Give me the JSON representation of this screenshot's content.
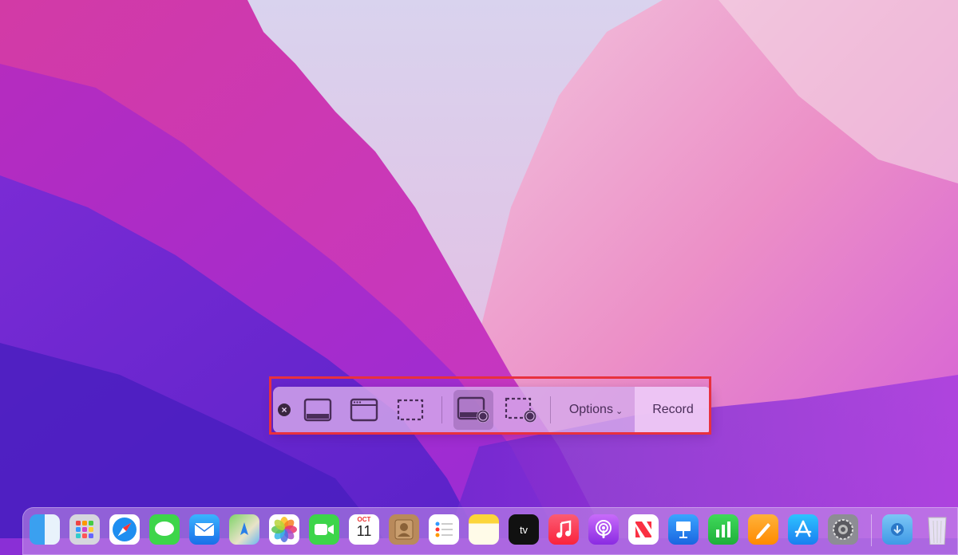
{
  "colors": {
    "highlight": "#e8313e",
    "toolbar_bg": "#d6aaeb",
    "toolbar_text": "#4a2d59"
  },
  "toolbar": {
    "close_icon": "close-icon",
    "tools": [
      {
        "name": "capture-entire-screen",
        "icon": "screen-icon",
        "selected": false
      },
      {
        "name": "capture-selected-window",
        "icon": "window-icon",
        "selected": false
      },
      {
        "name": "capture-selected-portion",
        "icon": "dashed-selection-icon",
        "selected": false
      },
      {
        "name": "record-entire-screen",
        "icon": "screen-record-icon",
        "selected": true
      },
      {
        "name": "record-selected-portion",
        "icon": "dashed-record-icon",
        "selected": false
      }
    ],
    "options_label": "Options",
    "options_chevron": "⌄",
    "record_label": "Record"
  },
  "dock": {
    "apps": [
      {
        "name": "finder",
        "icon": "finder-icon"
      },
      {
        "name": "launchpad",
        "icon": "launchpad-icon"
      },
      {
        "name": "safari",
        "icon": "safari-icon"
      },
      {
        "name": "messages",
        "icon": "messages-icon"
      },
      {
        "name": "mail",
        "icon": "mail-icon"
      },
      {
        "name": "maps",
        "icon": "maps-icon"
      },
      {
        "name": "photos",
        "icon": "photos-icon"
      },
      {
        "name": "facetime",
        "icon": "facetime-icon"
      },
      {
        "name": "calendar",
        "icon": "calendar-icon"
      },
      {
        "name": "contacts",
        "icon": "contacts-icon"
      },
      {
        "name": "reminders",
        "icon": "reminders-icon"
      },
      {
        "name": "notes",
        "icon": "notes-icon"
      },
      {
        "name": "tv",
        "icon": "tv-icon"
      },
      {
        "name": "music",
        "icon": "music-icon"
      },
      {
        "name": "podcasts",
        "icon": "podcasts-icon"
      },
      {
        "name": "news",
        "icon": "news-icon"
      },
      {
        "name": "keynote",
        "icon": "keynote-icon"
      },
      {
        "name": "numbers",
        "icon": "numbers-icon"
      },
      {
        "name": "pages",
        "icon": "pages-icon"
      },
      {
        "name": "app-store",
        "icon": "app-store-icon"
      },
      {
        "name": "system-preferences",
        "icon": "gear-icon"
      },
      {
        "name": "downloads",
        "icon": "downloads-folder-icon"
      },
      {
        "name": "trash",
        "icon": "trash-icon"
      }
    ],
    "calendar": {
      "month": "OCT",
      "day": "11"
    },
    "tv_label": "tv"
  }
}
